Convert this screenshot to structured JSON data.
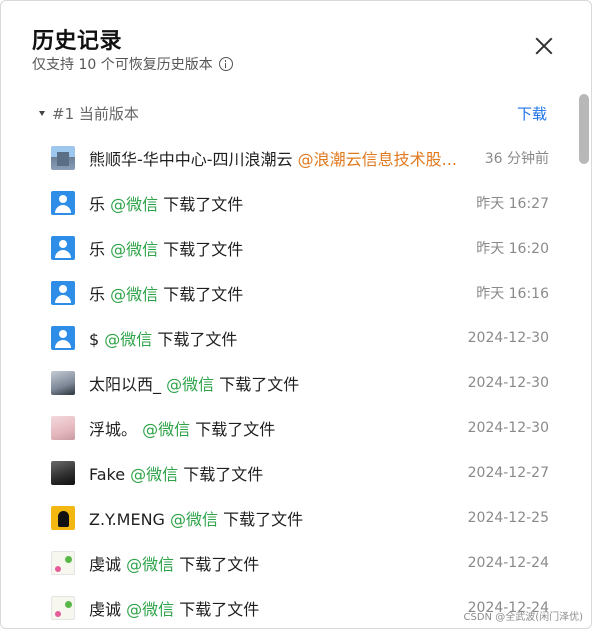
{
  "dialog": {
    "title": "历史记录",
    "subtitle": "仅支持 10 个可恢复历史版本",
    "close_label": "关闭"
  },
  "version": {
    "label": "#1 当前版本",
    "download_label": "下载"
  },
  "history": [
    {
      "avatar": "building-avatar",
      "name": "熊顺华-华中中心-四川浪潮云 ",
      "mention": "@浪潮云信息技术股...",
      "mention_color": "#e07a1f",
      "action": "",
      "time": "36 分钟前"
    },
    {
      "avatar": "default-user-icon",
      "name": "乐 ",
      "mention": "@微信",
      "mention_color": "#2fa34a",
      "action": " 下载了文件",
      "time": "昨天 16:27"
    },
    {
      "avatar": "default-user-icon",
      "name": "乐 ",
      "mention": "@微信",
      "mention_color": "#2fa34a",
      "action": " 下载了文件",
      "time": "昨天 16:20"
    },
    {
      "avatar": "default-user-icon",
      "name": "乐 ",
      "mention": "@微信",
      "mention_color": "#2fa34a",
      "action": " 下载了文件",
      "time": "昨天 16:16"
    },
    {
      "avatar": "default-user-icon",
      "name": "$ ",
      "mention": "@微信",
      "mention_color": "#2fa34a",
      "action": " 下载了文件",
      "time": "2024-12-30"
    },
    {
      "avatar": "photo-avatar",
      "name": "太阳以西_ ",
      "mention": "@微信",
      "mention_color": "#2fa34a",
      "action": " 下载了文件",
      "time": "2024-12-30"
    },
    {
      "avatar": "photo-avatar",
      "name": "浮城。 ",
      "mention": "@微信",
      "mention_color": "#2fa34a",
      "action": " 下载了文件",
      "time": "2024-12-30"
    },
    {
      "avatar": "photo-avatar",
      "name": "Fake ",
      "mention": "@微信",
      "mention_color": "#2fa34a",
      "action": " 下载了文件",
      "time": "2024-12-27"
    },
    {
      "avatar": "yellow-avatar",
      "name": "Z.Y.MENG ",
      "mention": "@微信",
      "mention_color": "#2fa34a",
      "action": " 下载了文件",
      "time": "2024-12-25"
    },
    {
      "avatar": "flower-avatar",
      "name": "虔诚 ",
      "mention": "@微信",
      "mention_color": "#2fa34a",
      "action": " 下载了文件",
      "time": "2024-12-24"
    },
    {
      "avatar": "flower-avatar",
      "name": "虔诚 ",
      "mention": "@微信",
      "mention_color": "#2fa34a",
      "action": " 下载了文件",
      "time": "2024-12-24"
    }
  ],
  "watermark": "CSDN @全武波(闲门泽优)"
}
